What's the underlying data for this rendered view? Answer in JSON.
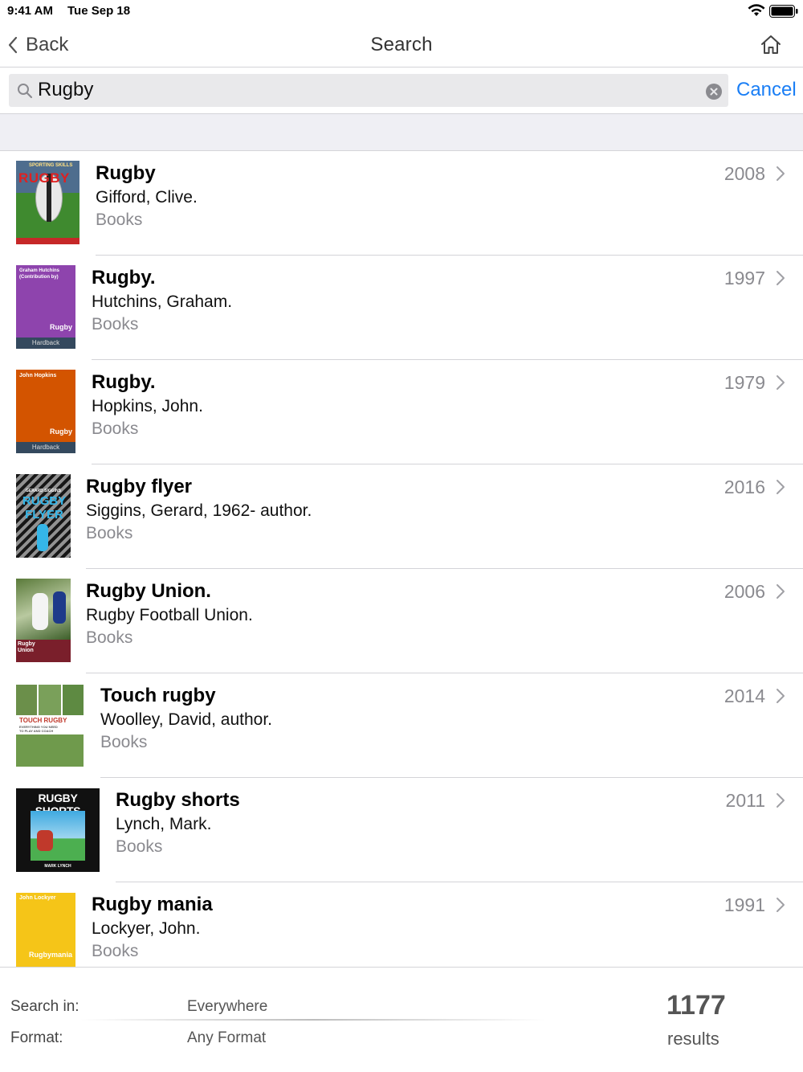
{
  "status_bar": {
    "time": "9:41 AM",
    "date": "Tue Sep 18"
  },
  "nav": {
    "back_label": "Back",
    "title": "Search"
  },
  "search": {
    "value": "Rugby",
    "cancel_label": "Cancel"
  },
  "results": [
    {
      "title": "Rugby",
      "author": "Gifford, Clive.",
      "format": "Books",
      "year": "2008",
      "cover": {
        "title_text": "RUGBY",
        "series_text": "SPORTING SKILLS",
        "bg": "#2f7a2f"
      }
    },
    {
      "title": "Rugby.",
      "author": "Hutchins, Graham.",
      "format": "Books",
      "year": "1997",
      "cover": {
        "author_text": "Graham Hutchins (Contribution by)",
        "title_text": "Rugby",
        "band_text": "Hardback",
        "bg": "#8e44ad"
      }
    },
    {
      "title": "Rugby.",
      "author": "Hopkins, John.",
      "format": "Books",
      "year": "1979",
      "cover": {
        "author_text": "John Hopkins",
        "title_text": "Rugby",
        "band_text": "Hardback",
        "bg": "#d35400"
      }
    },
    {
      "title": "Rugby flyer",
      "author": "Siggins, Gerard, 1962- author.",
      "format": "Books",
      "year": "2016",
      "cover": {
        "author_text": "GERARD SIGGINS",
        "title_text": "RUGBY FLYER",
        "bg": "#1f1f1f"
      }
    },
    {
      "title": "Rugby Union.",
      "author": "Rugby Football Union.",
      "format": "Books",
      "year": "2006",
      "cover": {
        "title_text": "Rugby Union",
        "bg": "#7a1f2b"
      }
    },
    {
      "title": "Touch rugby",
      "author": "Woolley, David, author.",
      "format": "Books",
      "year": "2014",
      "cover": {
        "title_text": "TOUCH RUGBY",
        "subtitle_text": "EVERYTHING YOU NEED TO PLAY AND COACH",
        "bg": "#ffffff"
      }
    },
    {
      "title": "Rugby shorts",
      "author": "Lynch, Mark.",
      "format": "Books",
      "year": "2011",
      "cover": {
        "title_text": "RUGBY SHORTS",
        "author_text": "MARK LYNCH",
        "bg": "#111111"
      }
    },
    {
      "title": "Rugby mania",
      "author": "Lockyer, John.",
      "format": "Books",
      "year": "1991",
      "cover": {
        "author_text": "John Lockyer",
        "title_text": "Rugbymania",
        "bg": "#f5c518"
      }
    }
  ],
  "footer": {
    "search_in_label": "Search in:",
    "search_in_value": "Everywhere",
    "format_label": "Format:",
    "format_value": "Any Format",
    "count": "1177",
    "count_label": "results"
  },
  "colors": {
    "accent": "#1a7ef5",
    "secondary_text": "#8a8a8f",
    "separator": "#d4d4d8",
    "band": "#efeff4"
  },
  "icons": [
    "chevron-left-icon",
    "home-icon",
    "search-icon",
    "clear-icon",
    "chevron-right-icon",
    "wifi-icon",
    "battery-icon"
  ]
}
